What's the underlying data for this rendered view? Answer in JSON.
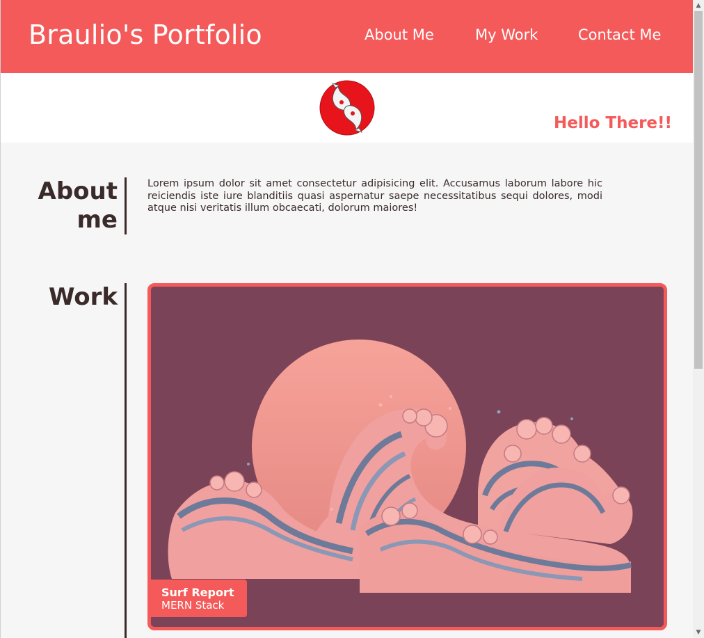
{
  "header": {
    "brand": "Braulio's Portfolio",
    "nav": [
      {
        "label": "About Me"
      },
      {
        "label": "My Work"
      },
      {
        "label": "Contact Me"
      }
    ]
  },
  "hero": {
    "greeting": "Hello There!!",
    "logo_icon": "koi-fish-logo-icon"
  },
  "about": {
    "title": "About me",
    "body": "Lorem ipsum dolor sit amet consectetur adipisicing elit. Accusamus laborum labore hic reiciendis iste iure blanditiis quasi aspernatur saepe necessitatibus sequi dolores, modi atque nisi veritatis illum obcaecati, dolorum maiores!"
  },
  "work": {
    "title": "Work",
    "projects": [
      {
        "title": "Surf Report",
        "subtitle": "MERN Stack",
        "image_icon": "great-wave-sunset-image"
      }
    ]
  },
  "colors": {
    "accent": "#f55a5a",
    "text": "#3a2a2a",
    "card_bg": "#7a4358",
    "page_bg": "#f6f6f6"
  }
}
